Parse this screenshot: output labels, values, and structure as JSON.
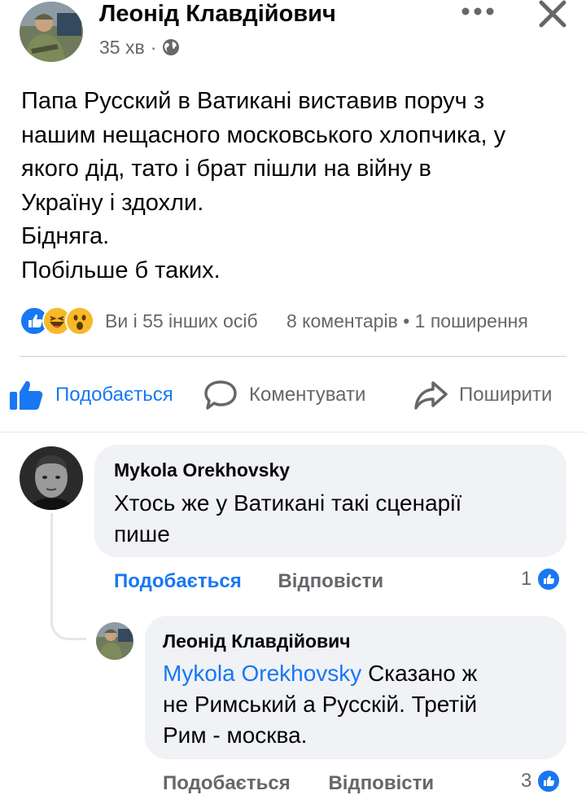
{
  "post": {
    "author": "Леонід Клавдійович",
    "time": "35 хв",
    "separator": "·",
    "privacy_icon": "globe-icon",
    "text": "Папа Русский в Ватикані виставив поруч з\nнашим нещасного московського хлопчика, у\nякого дід, тато і брат пішли на війну в\nУкраїну і здохли.\nБідняга.\nПобільше б таких."
  },
  "reactions": {
    "icons": [
      "like",
      "haha",
      "wow"
    ],
    "summary": "Ви і 55 інших осіб",
    "comments": "8 коментарів",
    "dot": "•",
    "shares": "1 поширення"
  },
  "actions": {
    "like": "Подобається",
    "comment": "Коментувати",
    "share": "Поширити"
  },
  "comments": [
    {
      "author": "Mykola Orekhovsky",
      "text": "Хтось же у Ватикані такі сценарії\nпише",
      "like_label": "Подобається",
      "reply_label": "Відповісти",
      "reaction_count": "1"
    },
    {
      "author": "Леонід Клавдійович",
      "mention": "Mykola Orekhovsky",
      "text_line1": " Сказано ж",
      "text_rest": "не Римський а Русскій. Третій\nРим - москва.",
      "like_label": "Подобається",
      "reply_label": "Відповісти",
      "reaction_count": "3"
    }
  ],
  "colors": {
    "accent": "#1877f2",
    "secondary_text": "#65676b",
    "bubble": "#f0f2f5",
    "haha": "#f7b928",
    "wow": "#f7b928"
  }
}
